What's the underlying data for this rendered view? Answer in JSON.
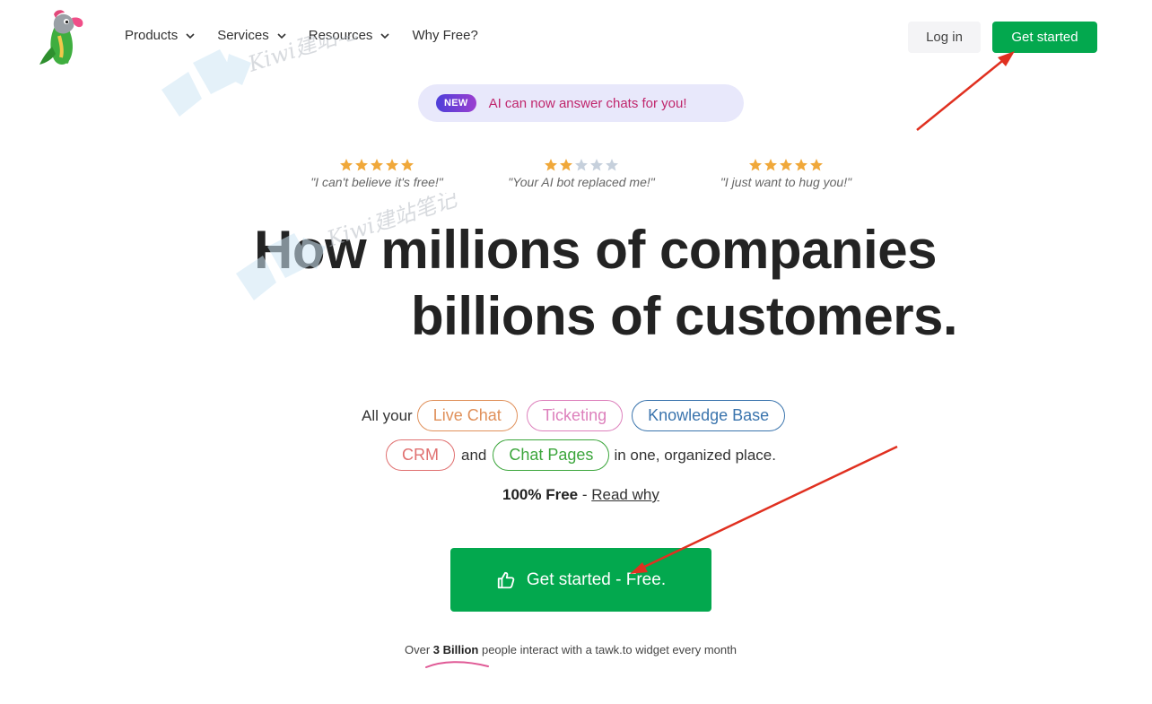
{
  "header": {
    "nav": [
      {
        "label": "Products",
        "has_dropdown": true
      },
      {
        "label": "Services",
        "has_dropdown": true
      },
      {
        "label": "Resources",
        "has_dropdown": true
      },
      {
        "label": "Why Free?",
        "has_dropdown": false
      }
    ],
    "login_label": "Log in",
    "cta_label": "Get started"
  },
  "announcement": {
    "badge": "NEW",
    "text": "AI can now answer chats for you!"
  },
  "reviews": [
    {
      "stars": 5,
      "quote": "\"I can't believe it's free!\""
    },
    {
      "stars": 2,
      "quote": "\"Your AI bot replaced me!\""
    },
    {
      "stars": 5,
      "quote": "\"I just want to hug you!\""
    }
  ],
  "hero": {
    "line1": "How millions of companies",
    "line2": "billions of customers."
  },
  "features": {
    "prefix": "All your",
    "live_chat": "Live Chat",
    "ticketing": "Ticketing",
    "knowledge_base": "Knowledge Base",
    "crm": "CRM",
    "and": "and",
    "chat_pages": "Chat Pages",
    "suffix": "in one, organized place."
  },
  "free": {
    "bold": "100% Free",
    "sep": " - ",
    "link": "Read why"
  },
  "main_cta": {
    "label": "Get started - Free.",
    "icon": "thumbs-up-icon"
  },
  "stat": {
    "pre": "Over ",
    "bold": "3 Billion",
    "post": " people interact with a tawk.to widget every month"
  },
  "watermark_text": "Kiwi建站笔记",
  "colors": {
    "brand_green": "#03a84e",
    "announce_bg": "#e8e8fb",
    "announce_text": "#c0266c",
    "star_filled": "#f0a83a",
    "star_empty": "#c6d0dc",
    "annotation_arrow": "#e03020"
  }
}
